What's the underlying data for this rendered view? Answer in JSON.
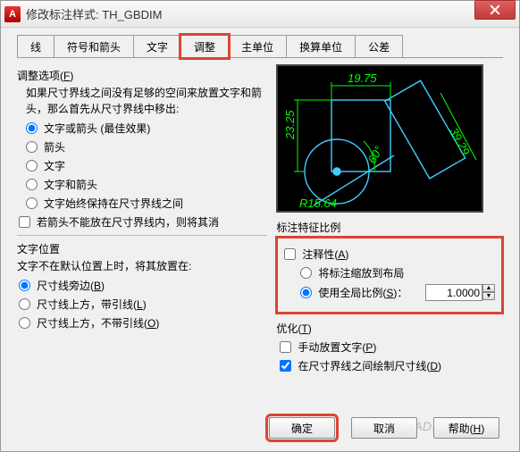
{
  "window": {
    "title": "修改标注样式: TH_GBDIM"
  },
  "tabs": [
    "线",
    "符号和箭头",
    "文字",
    "调整",
    "主单位",
    "换算单位",
    "公差"
  ],
  "active_tab": 3,
  "fit": {
    "group_title_pre": "调整选项(",
    "group_title_key": "F",
    "group_title_post": ")",
    "desc": "如果尺寸界线之间没有足够的空间来放置文字和箭头，那么首先从尺寸界线中移出:",
    "opt_either": "文字或箭头 (最佳效果)",
    "opt_arrows": "箭头",
    "opt_text": "文字",
    "opt_both": "文字和箭头",
    "opt_always": "文字始终保持在尺寸界线之间",
    "chk_suppress": "若箭头不能放在尺寸界线内，则将其消"
  },
  "textpos": {
    "title": "文字位置",
    "desc": "文字不在默认位置上时，将其放置在:",
    "opt_beside_pre": "尺寸线旁边(",
    "opt_beside_key": "B",
    "opt_beside_post": ")",
    "opt_over_leader_pre": "尺寸线上方，带引线(",
    "opt_over_leader_key": "L",
    "opt_over_leader_post": ")",
    "opt_over_noleader_pre": "尺寸线上方，不带引线(",
    "opt_over_noleader_key": "O",
    "opt_over_noleader_post": ")"
  },
  "scale": {
    "title_pre": "标注特征比例",
    "chk_annotative_pre": "注释性(",
    "chk_annotative_key": "A",
    "chk_annotative_post": ")",
    "opt_layout": "将标注缩放到布局",
    "opt_global_pre": "使用全局比例(",
    "opt_global_key": "S",
    "opt_global_post": ")：",
    "value": "1.0000"
  },
  "tune": {
    "title_pre": "优化(",
    "title_key": "T",
    "title_post": ")",
    "chk_manual_pre": "手动放置文字(",
    "chk_manual_key": "P",
    "chk_manual_post": ")",
    "chk_dimline_pre": "在尺寸界线之间绘制尺寸线(",
    "chk_dimline_key": "D",
    "chk_dimline_post": ")"
  },
  "preview": {
    "d1": "19.75",
    "d2": "23.25",
    "d3": "39.29",
    "ang": "60°",
    "rad": "R15.64"
  },
  "buttons": {
    "ok": "确定",
    "cancel": "取消",
    "help_pre": "帮助(",
    "help_key": "H",
    "help_post": ")"
  },
  "watermark": "AutoCAD教程"
}
